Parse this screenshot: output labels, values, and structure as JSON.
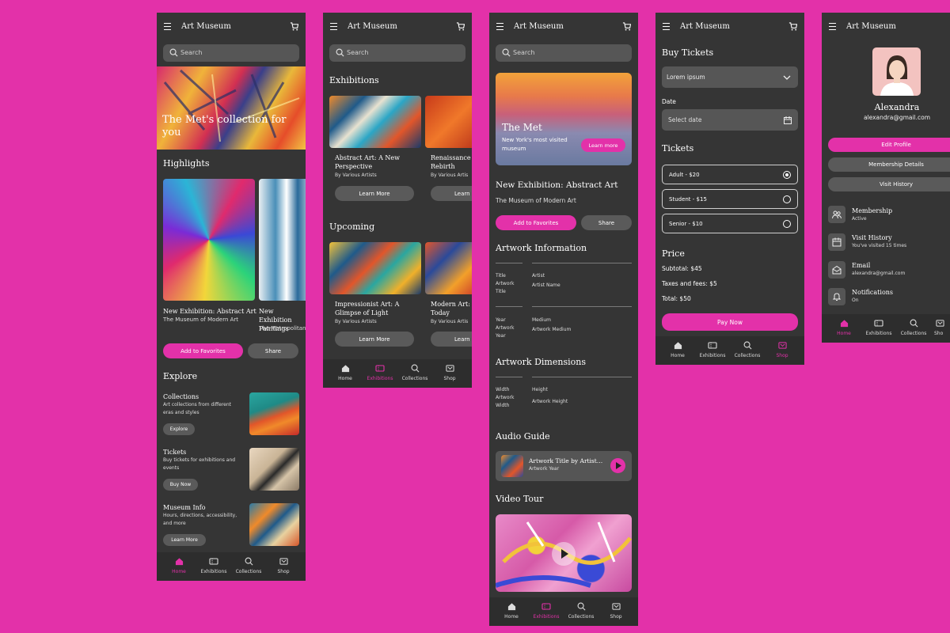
{
  "app": {
    "title": "Art Museum",
    "search_placeholder": "Search",
    "colors": {
      "accent": "#e331a9",
      "surface": "#353535",
      "field": "#565656",
      "button_gray": "#5a5a5a"
    },
    "nav": {
      "home": "Home",
      "exhibitions": "Exhibitions",
      "collections": "Collections",
      "shop": "Shop"
    }
  },
  "home": {
    "hero_text": "The Met's collection for you",
    "highlights_title": "Highlights",
    "card1_title": "New Exhibition: Abstract Art",
    "card1_sub": "The Museum of Modern Art",
    "card2_title": "New Exhibition Paintings",
    "card2_sub": "The Metropolitan",
    "add_favorites": "Add to Favorites",
    "share": "Share",
    "explore_title": "Explore",
    "explore": [
      {
        "title": "Collections",
        "desc": "Art collections from different eras and styles",
        "button": "Explore"
      },
      {
        "title": "Tickets",
        "desc": "Buy tickets for exhibitions and events",
        "button": "Buy Now"
      },
      {
        "title": "Museum Info",
        "desc": "Hours, directions, accessibility, and more",
        "button": "Learn More"
      }
    ]
  },
  "exhibitions": {
    "exhibitions_title": "Exhibitions",
    "upcoming_title": "Upcoming",
    "learn_more": "Learn More",
    "by": "By Various Artists",
    "by_short": "By Various Artis",
    "e1": "Abstract Art: A New Perspective",
    "e2": "Renaissance A Rebirth",
    "u1": "Impressionist Art: A Glimpse of Light",
    "u2": "Modern Art: T Today",
    "learn_short": "Learn"
  },
  "detail": {
    "hero_title": "The Met",
    "hero_sub": "New York's most visited museum",
    "learn_more": "Learn more",
    "title": "New Exhibition: Abstract Art",
    "subtitle": "The Museum of Modern Art",
    "add_favorites": "Add to Favorites",
    "share": "Share",
    "artwork_info": "Artwork Information",
    "title_label": "Title",
    "artwork_title": "Artwork Title",
    "artist_label": "Artist",
    "artist_name": "Artist Name",
    "year_label": "Year",
    "artwork_year": "Artwork Year",
    "medium_label": "Medium",
    "artwork_medium": "Artwork Medium",
    "dimensions": "Artwork Dimensions",
    "width_label": "Width",
    "artwork_width": "Artwork Width",
    "height_label": "Height",
    "artwork_height": "Artwork Height",
    "audio_guide": "Audio Guide",
    "audio_title": "Artwork Title by Artist…",
    "audio_sub": "Artwork Year",
    "video_tour": "Video Tour"
  },
  "tickets": {
    "title": "Buy Tickets",
    "select_value": "Lorem ipsum",
    "date_label": "Date",
    "date_placeholder": "Select date",
    "tickets_title": "Tickets",
    "options": [
      "Adult - $20",
      "Student - $15",
      "Senior - $10"
    ],
    "price_title": "Price",
    "subtotal": "Subtotal: $45",
    "fees": "Taxes and fees: $5",
    "total": "Total: $50",
    "pay": "Pay Now"
  },
  "profile": {
    "name": "Alexandra",
    "email": "alexandra@gmail.com",
    "edit": "Edit Profile",
    "membership_details": "Membership Details",
    "visit_history": "Visit History",
    "items": [
      {
        "title": "Membership",
        "sub": "Active"
      },
      {
        "title": "Visit History",
        "sub": "You've visited 15 times"
      },
      {
        "title": "Email",
        "sub": "alexandra@gmail.com"
      },
      {
        "title": "Notifications",
        "sub": "On"
      }
    ],
    "nav_short": "Sho"
  }
}
